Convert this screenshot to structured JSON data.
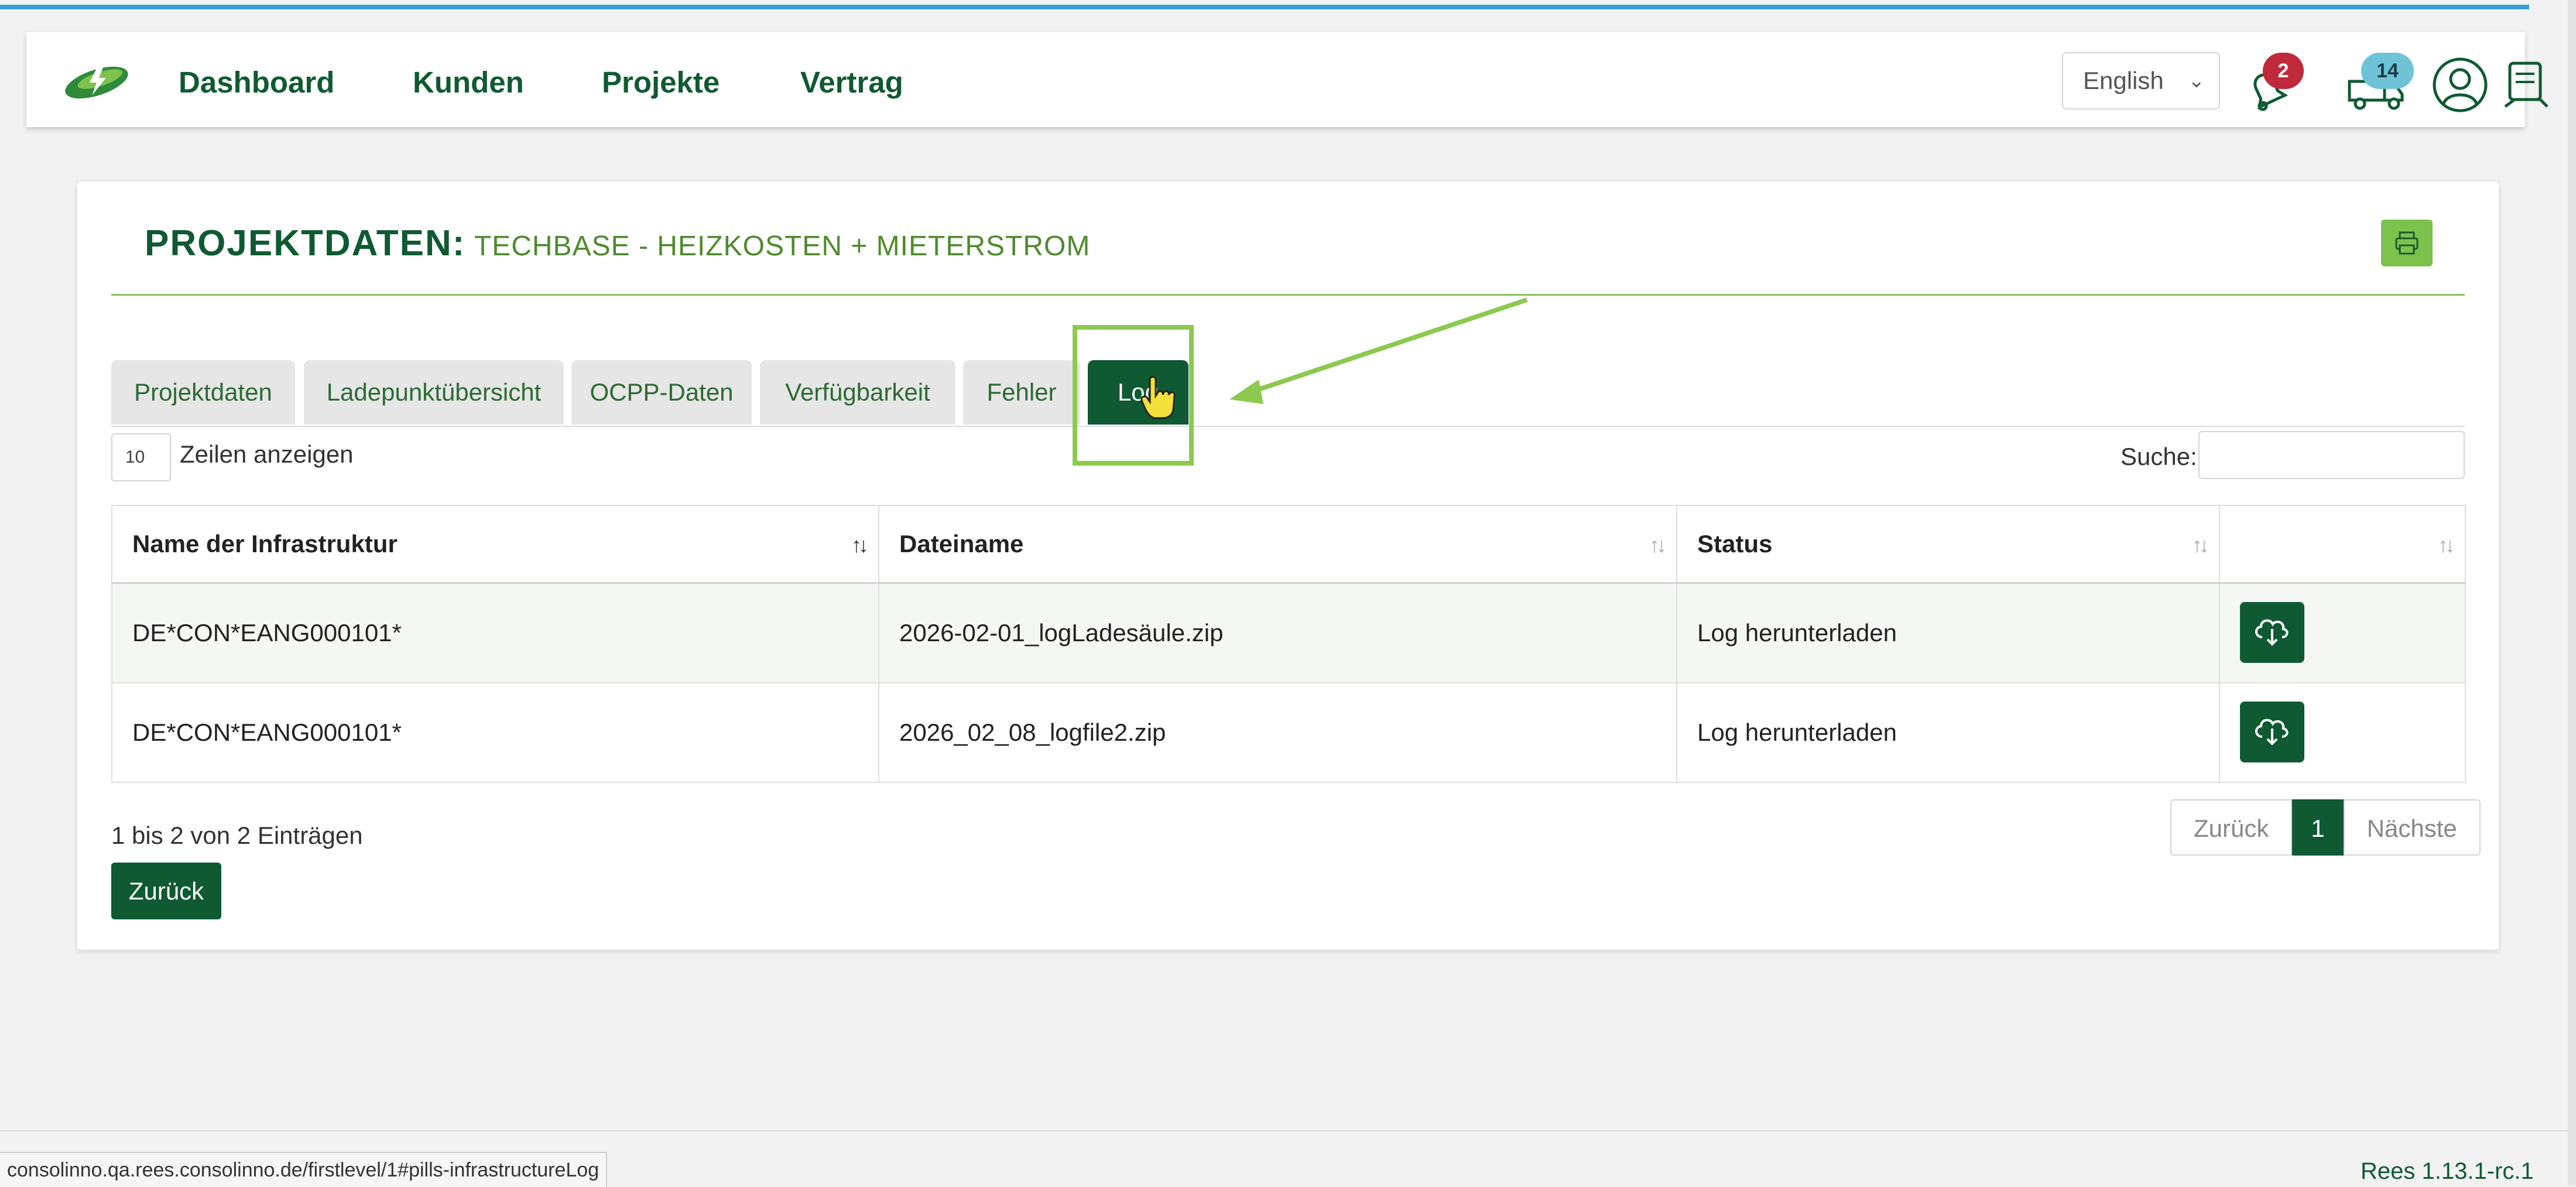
{
  "nav": {
    "links": [
      "Dashboard",
      "Kunden",
      "Projekte",
      "Vertrag"
    ],
    "language": "English",
    "bell_badge": "2",
    "truck_badge": "14",
    "icons": [
      "lightning-logo-icon",
      "bell-icon",
      "truck-icon",
      "user-circle-icon",
      "user-card-icon"
    ]
  },
  "page": {
    "title_strong": "PROJEKTDATEN:",
    "title_light": "TECHBASE - HEIZKOSTEN + MIETERSTROM"
  },
  "tabs": [
    "Projektdaten",
    "Ladepunktübersicht",
    "OCPP-Daten",
    "Verfügbarkeit",
    "Fehler",
    "Log"
  ],
  "active_tab": "Log",
  "table_controls": {
    "length_value": "10",
    "length_label": "Zeilen anzeigen",
    "search_label": "Suche:",
    "search_value": ""
  },
  "table": {
    "headers": [
      "Name der Infrastruktur",
      "Dateiname",
      "Status",
      ""
    ],
    "rows": [
      {
        "name": "DE*CON*EANG000101*",
        "file": "2026-02-01_logLadesäule.zip",
        "status": "Log herunterladen"
      },
      {
        "name": "DE*CON*EANG000101*",
        "file": "2026_02_08_logfile2.zip",
        "status": "Log herunterladen"
      }
    ]
  },
  "footer": {
    "info": "1 bis 2 von 2 Einträgen",
    "prev": "Zurück",
    "page": "1",
    "next": "Nächste",
    "back_button": "Zurück"
  },
  "status_bar": {
    "url": "consolinno.qa.rees.consolinno.de/firstlevel/1#pills-infrastructureLog",
    "version": "Rees 1.13.1-rc.1"
  },
  "colors": {
    "brand_dark": "#0f5a32",
    "accent_green": "#8cc94f",
    "title_light": "#4f8a2e",
    "bell_badge": "#c0283c",
    "truck_badge": "#6ec3d6",
    "top_line": "#3b9fd4"
  }
}
